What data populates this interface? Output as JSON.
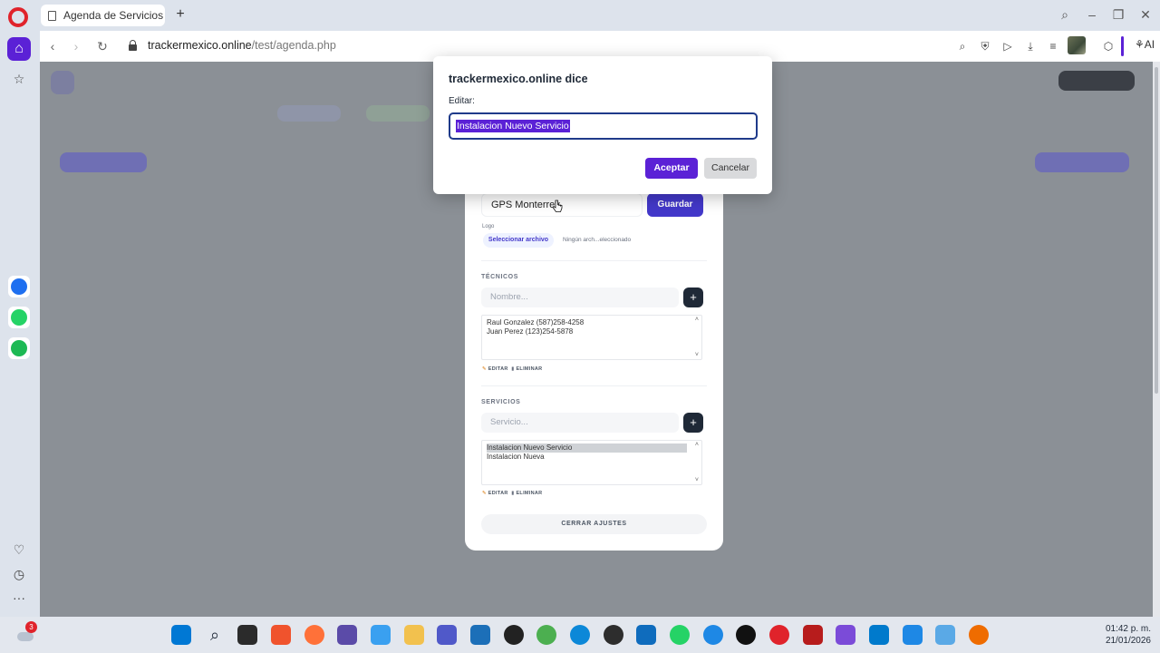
{
  "browser": {
    "tab_title": "Agenda de Servicios - Tra",
    "url_host": "trackermexico.online",
    "url_path": "/test/agenda.php",
    "ai_label": "AI"
  },
  "dialog": {
    "title": "trackermexico.online dice",
    "label": "Editar:",
    "input_value": "Instalacion Nuevo Servicio",
    "accept_label": "Aceptar",
    "cancel_label": "Cancelar"
  },
  "settings": {
    "company_value": "GPS Monterrey",
    "save_label": "Guardar",
    "logo_label": "Logo",
    "file_button": "Seleccionar archivo",
    "file_status": "Ningún arch...eleccionado",
    "technicians": {
      "title": "TÉCNICOS",
      "placeholder": "Nombre...",
      "items": [
        "Raul Gonzalez (587)258-4258",
        "Juan Perez (123)254-5878"
      ],
      "edit_label": "EDITAR",
      "delete_label": "ELIMINAR"
    },
    "services": {
      "title": "SERVICIOS",
      "placeholder": "Servicio...",
      "items": [
        "Instalacion Nuevo Servicio",
        "Instalacion Nueva"
      ],
      "edit_label": "EDITAR",
      "delete_label": "ELIMINAR"
    },
    "close_label": "CERRAR AJUSTES"
  },
  "taskbar": {
    "time": "01:42 p. m.",
    "date": "21/01/2026",
    "notification_count": "3"
  },
  "colors": {
    "accent": "#5b21d6",
    "save_button": "#4338ca",
    "overlay": "#8b9096"
  }
}
